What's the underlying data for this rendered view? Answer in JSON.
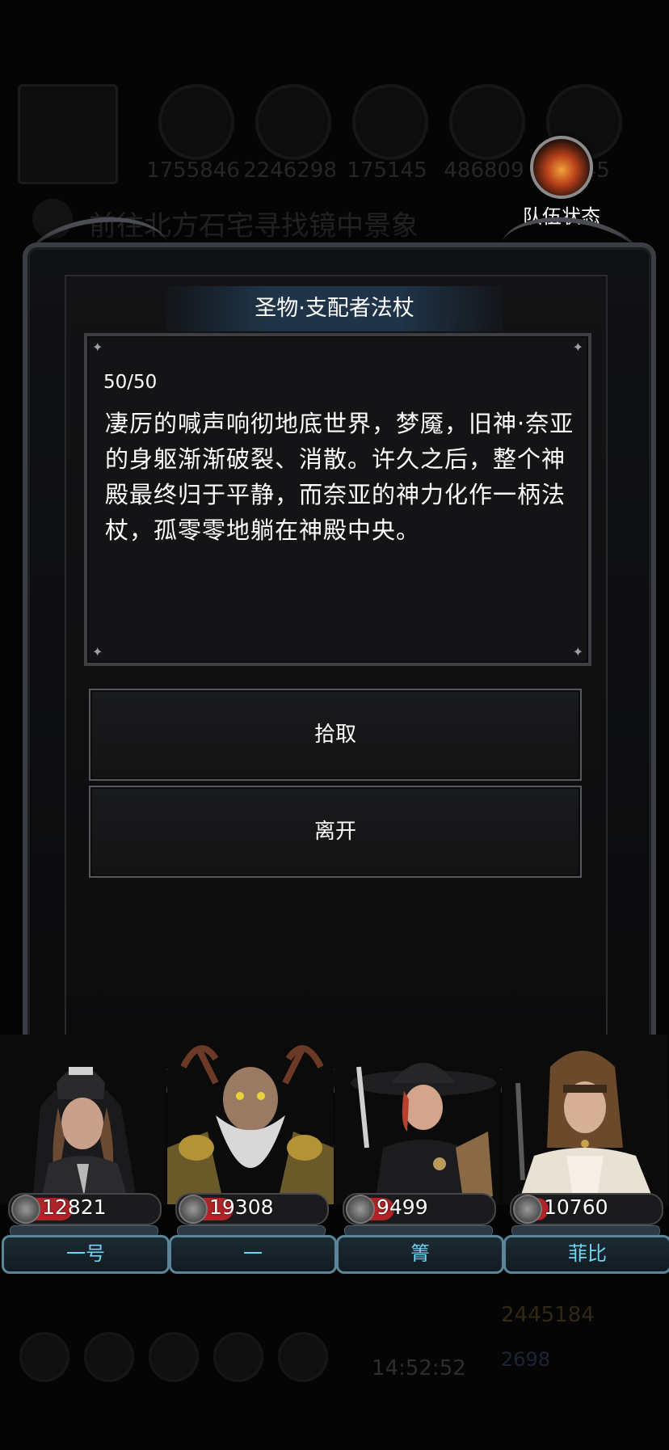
{
  "background": {
    "resources": [
      "1755846",
      "2246298",
      "175145",
      "486809",
      "445"
    ],
    "quest_text": "前往北方石宅寻找镜中景象",
    "clock": "14:52:52",
    "gold": "2445184",
    "gems": "2698"
  },
  "team_status": {
    "label": "队伍状态",
    "icon": "fire-emblem-icon"
  },
  "dialog": {
    "title": "圣物·支配者法杖",
    "counter": "50/50",
    "description": "凄厉的喊声响彻地底世界，梦魇，旧神·奈亚的身躯渐渐破裂、消散。许久之后，整个神殿最终归于平静，而奈亚的神力化作一柄法杖，孤零零地躺在神殿中央。",
    "options": [
      {
        "label": "拾取"
      },
      {
        "label": "离开"
      }
    ]
  },
  "party": [
    {
      "name": "一号",
      "hp": "12821",
      "hp_fraction": 0.35,
      "art": "nun-warrior"
    },
    {
      "name": "一",
      "hp": "19308",
      "hp_fraction": 0.3,
      "art": "antlered-elder"
    },
    {
      "name": "箐",
      "hp": "9499",
      "hp_fraction": 0.25,
      "art": "witch-hat-girl"
    },
    {
      "name": "菲比",
      "hp": "10760",
      "hp_fraction": 0.15,
      "art": "noble-lady"
    }
  ],
  "colors": {
    "hp_fill": "#b02328",
    "name_text": "#6fd4f0",
    "title_bar": "#1f3448"
  }
}
